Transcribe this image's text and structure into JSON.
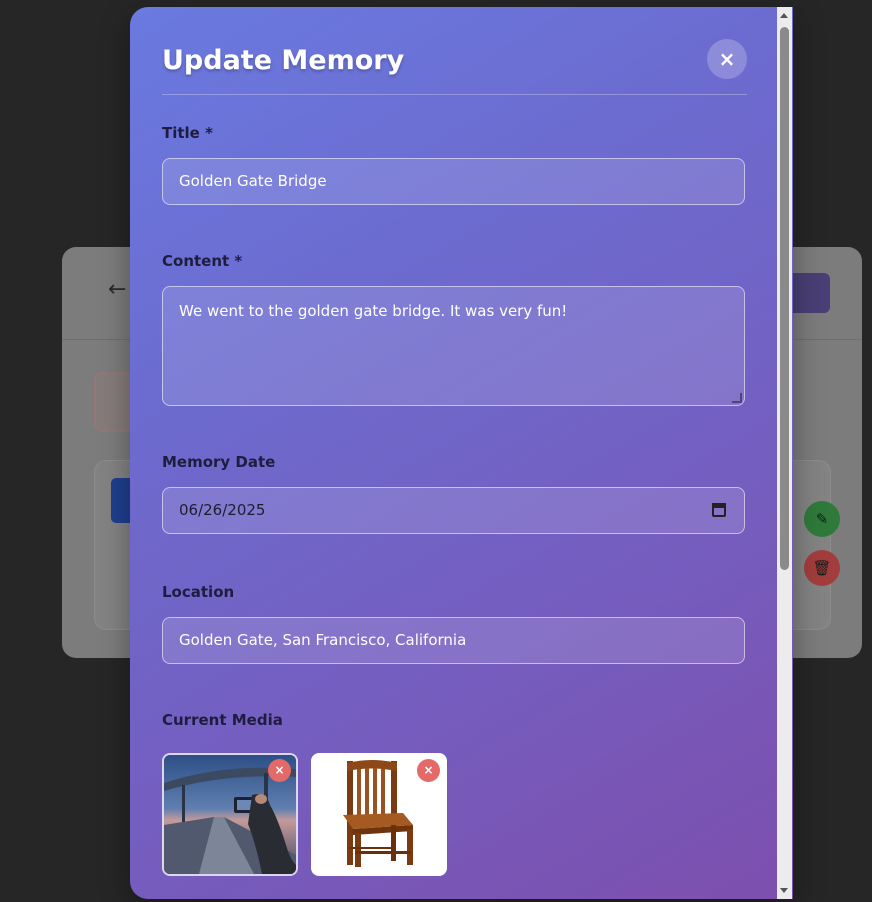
{
  "background": {
    "back_arrow": "←"
  },
  "modal": {
    "title": "Update Memory",
    "close_symbol": "×",
    "fields": {
      "title": {
        "label": "Title *",
        "value": "Golden Gate Bridge"
      },
      "content": {
        "label": "Content *",
        "value": "We went to the golden gate bridge. It was very fun!"
      },
      "memory_date": {
        "label": "Memory Date",
        "value": "06/26/2025"
      },
      "location": {
        "label": "Location",
        "value": "Golden Gate, San Francisco, California"
      }
    },
    "current_media": {
      "label": "Current Media",
      "items": [
        {
          "alt": "bridge photo",
          "remove_symbol": "×"
        },
        {
          "alt": "wooden chair",
          "remove_symbol": "×"
        }
      ]
    }
  },
  "colors": {
    "gradient_start": "#6a7ae0",
    "gradient_end": "#7d4fad",
    "remove_button": "#e46a6a"
  }
}
